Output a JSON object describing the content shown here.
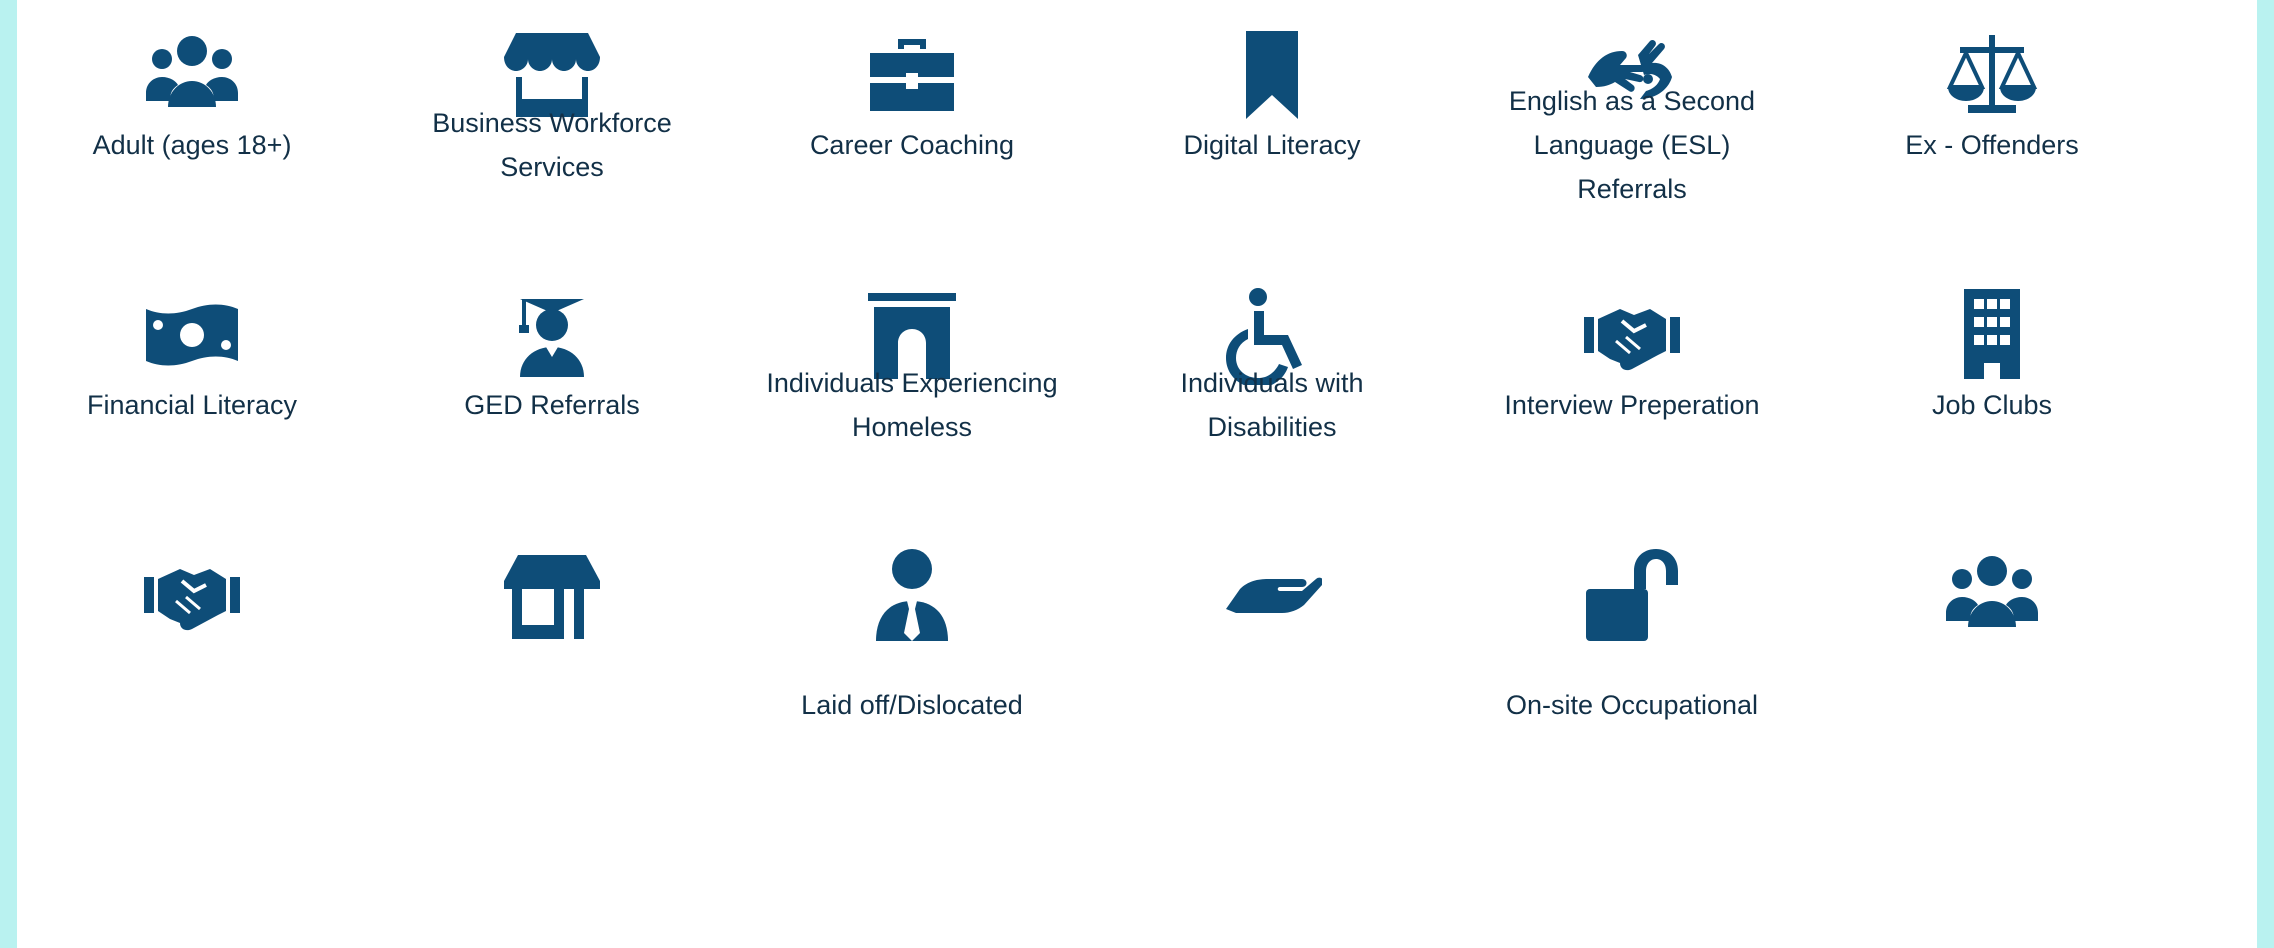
{
  "colors": {
    "icon": "#0e4d78",
    "text": "#123047",
    "frame": "#b9f2f0",
    "panel": "#ffffff"
  },
  "services": [
    {
      "icon": "users-icon",
      "lines": [
        "Adult (ages 18+)"
      ]
    },
    {
      "icon": "storefront-icon",
      "lines": [
        "Business Workforce",
        "Services"
      ]
    },
    {
      "icon": "briefcase-icon",
      "lines": [
        "Career Coaching"
      ]
    },
    {
      "icon": "bookmark-icon",
      "lines": [
        "Digital Literacy"
      ]
    },
    {
      "icon": "sign-language-icon",
      "lines": [
        "English as a Second",
        "Language (ESL)",
        "Referrals"
      ]
    },
    {
      "icon": "balance-scale-icon",
      "lines": [
        "Ex - Offenders"
      ]
    },
    {
      "icon": "money-bill-icon",
      "lines": [
        "Financial Literacy"
      ]
    },
    {
      "icon": "graduate-icon",
      "lines": [
        "GED Referrals"
      ]
    },
    {
      "icon": "archway-icon",
      "lines": [
        "Individuals Experiencing",
        "Homeless"
      ]
    },
    {
      "icon": "wheelchair-icon",
      "lines": [
        "Individuals with",
        "Disabilities"
      ]
    },
    {
      "icon": "handshake-icon",
      "lines": [
        "Interview Preperation"
      ]
    },
    {
      "icon": "building-icon",
      "lines": [
        "Job Clubs"
      ]
    },
    {
      "icon": "handshake-icon",
      "lines": []
    },
    {
      "icon": "store-icon",
      "lines": []
    },
    {
      "icon": "businessman-icon",
      "lines": [
        "Laid off/Dislocated"
      ]
    },
    {
      "icon": "open-hand-icon",
      "lines": []
    },
    {
      "icon": "unlock-icon",
      "lines": [
        "On-site Occupational"
      ]
    },
    {
      "icon": "users-icon",
      "lines": []
    }
  ]
}
